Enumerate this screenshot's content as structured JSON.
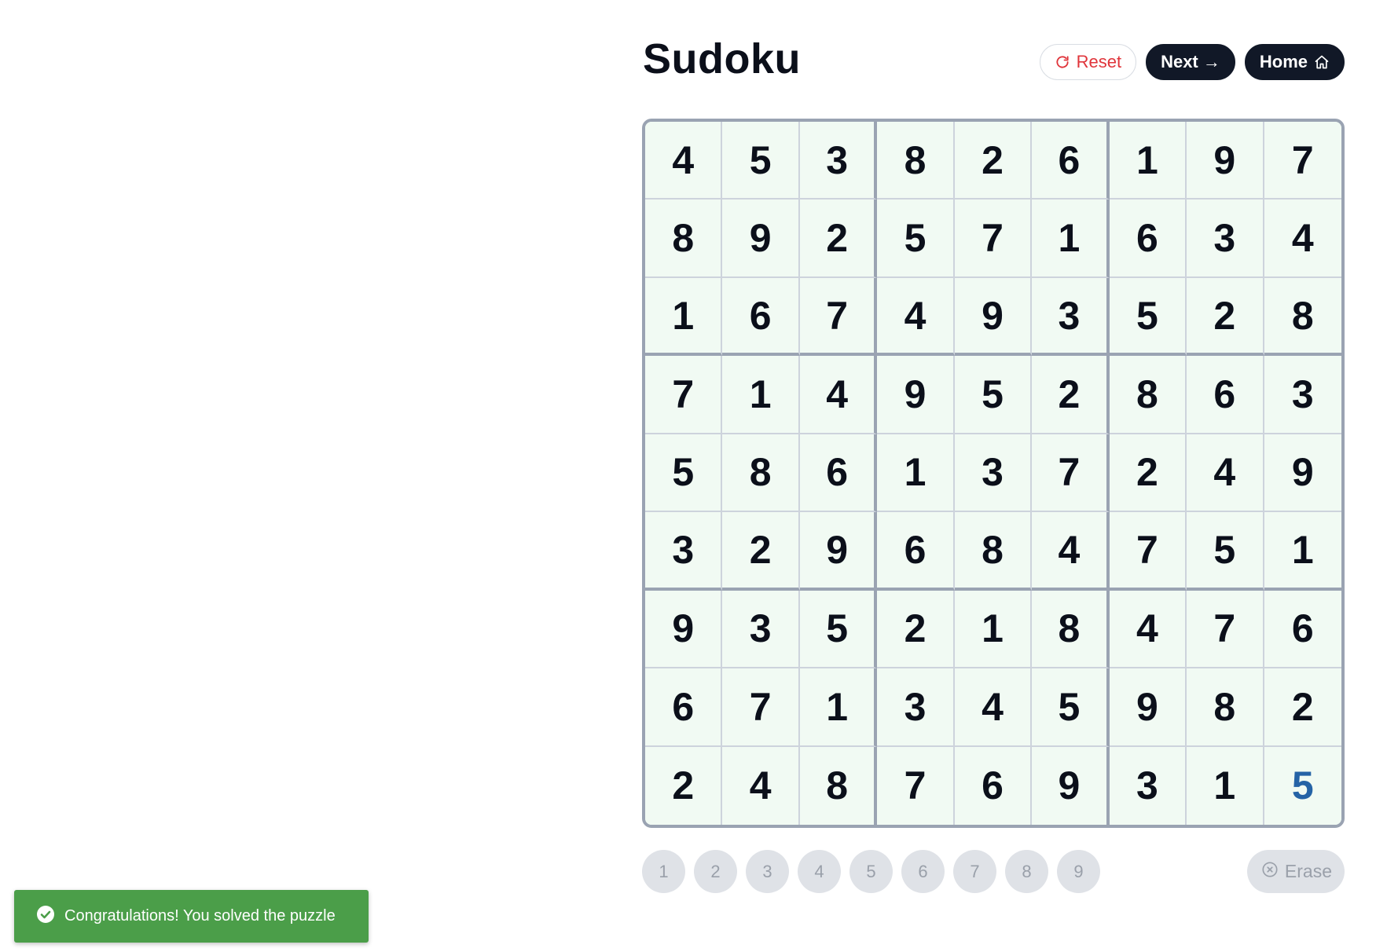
{
  "header": {
    "title": "Sudoku",
    "reset_label": "Reset",
    "next_label": "Next →",
    "home_label": "Home"
  },
  "board": {
    "cells": [
      [
        "4",
        "5",
        "3",
        "8",
        "2",
        "6",
        "1",
        "9",
        "7"
      ],
      [
        "8",
        "9",
        "2",
        "5",
        "7",
        "1",
        "6",
        "3",
        "4"
      ],
      [
        "1",
        "6",
        "7",
        "4",
        "9",
        "3",
        "5",
        "2",
        "8"
      ],
      [
        "7",
        "1",
        "4",
        "9",
        "5",
        "2",
        "8",
        "6",
        "3"
      ],
      [
        "5",
        "8",
        "6",
        "1",
        "3",
        "7",
        "2",
        "4",
        "9"
      ],
      [
        "3",
        "2",
        "9",
        "6",
        "8",
        "4",
        "7",
        "5",
        "1"
      ],
      [
        "9",
        "3",
        "5",
        "2",
        "1",
        "8",
        "4",
        "7",
        "6"
      ],
      [
        "6",
        "7",
        "1",
        "3",
        "4",
        "5",
        "9",
        "8",
        "2"
      ],
      [
        "2",
        "4",
        "8",
        "7",
        "6",
        "9",
        "3",
        "1",
        "5"
      ]
    ],
    "user_entered": [
      [
        8,
        8
      ]
    ]
  },
  "numpad": {
    "digits": [
      "1",
      "2",
      "3",
      "4",
      "5",
      "6",
      "7",
      "8",
      "9"
    ],
    "erase_label": "Erase"
  },
  "toast": {
    "message": "Congratulations! You solved the puzzle"
  },
  "colors": {
    "board_background": "#f1faf3",
    "user_digit": "#2563a6",
    "reset_text": "#e0353b",
    "dark_button": "#111827",
    "toast_background": "#4b9e49"
  },
  "icons": {
    "reset": "refresh-icon",
    "home": "home-icon",
    "erase": "circle-x-icon",
    "toast": "check-circle-icon"
  }
}
